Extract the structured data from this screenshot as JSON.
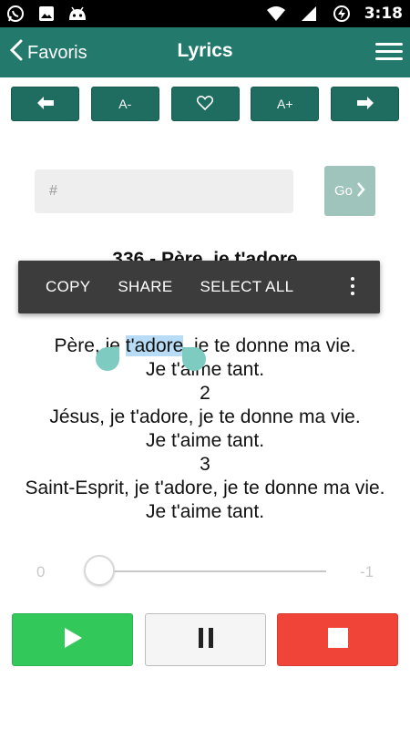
{
  "status_bar": {
    "time": "3:18",
    "left_icons": [
      "whatsapp-icon",
      "image-icon",
      "android-icon"
    ],
    "right_icons": [
      "wifi-icon",
      "signal-icon",
      "battery-charging-icon"
    ]
  },
  "app_bar": {
    "back_label": "Favoris",
    "title": "Lyrics",
    "color": "#237a6c"
  },
  "toolbar": {
    "prev_icon": "arrow-left-icon",
    "font_decrease_label": "A-",
    "favorite_icon": "heart-icon",
    "font_increase_label": "A+",
    "next_icon": "arrow-right-icon"
  },
  "search": {
    "placeholder": "#",
    "value": "",
    "go_label": "Go"
  },
  "context_menu": {
    "copy": "COPY",
    "share": "SHARE",
    "select_all": "SELECT ALL"
  },
  "lyrics": {
    "song_title": "336 - Père, je t'adore",
    "line1_before": "Père, je ",
    "line1_selected": "t'adore",
    "line1_after": ", je te donne ma vie.",
    "line2": "Je t'aime tant.",
    "verse2_number": "2",
    "line3": "Jésus, je t'adore, je te donne ma vie.",
    "line4": "Je t'aime tant.",
    "verse3_number": "3",
    "line5": "Saint-Esprit, je t'adore, je te donne ma vie.",
    "line6": "Je t'aime tant."
  },
  "seek_bar": {
    "start_label": "0",
    "end_label": "-1",
    "progress": 0.0
  },
  "playback": {
    "play_color": "#33c95a",
    "pause_color": "#f5f5f5",
    "stop_color": "#ef4437"
  }
}
